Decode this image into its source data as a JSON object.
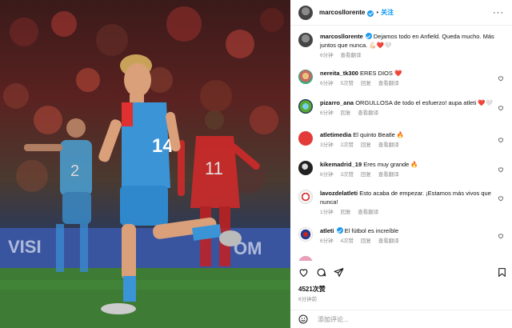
{
  "post": {
    "username": "marcosllorente",
    "follow_label": "关注",
    "more_label": "···"
  },
  "caption": {
    "username": "marcosllorente",
    "text": "Dejamos todo en Anfield. Queda mucho. Más juntos que nunca. 💪🏻❤️🤍",
    "time": "6分钟",
    "translate": "查看翻译"
  },
  "comments": [
    {
      "username": "nereita_tk300",
      "text": "ERES DIOS ❤️",
      "time": "6分钟",
      "likes": "5次赞",
      "reply": "回复",
      "translate": "查看翻译",
      "avatar": "av-1"
    },
    {
      "username": "pizarro_ana",
      "text": "ORGULLOSA de todo el esfuerzo! aupa atleti ❤️🤍",
      "time": "6分钟",
      "likes": "",
      "reply": "回复",
      "translate": "查看翻译",
      "avatar": "av-2"
    },
    {
      "username": "atletimedia",
      "text": "El quinto Beatle 🔥",
      "time": "3分钟",
      "likes": "2次赞",
      "reply": "回复",
      "translate": "查看翻译",
      "avatar": "av-3"
    },
    {
      "username": "kikemadrid_19",
      "text": "Eres muy grande 🔥",
      "time": "6分钟",
      "likes": "3次赞",
      "reply": "回复",
      "translate": "查看翻译",
      "avatar": "av-4"
    },
    {
      "username": "lavozdelatleti",
      "text": "Esto acaba de empezar. ¡Estamos más vivos que nunca!",
      "time": "1分钟",
      "likes": "",
      "reply": "回复",
      "translate": "查看翻译",
      "avatar": "av-5"
    },
    {
      "username": "atleti",
      "text": "El fútbol es increíble",
      "time": "6分钟",
      "likes": "4次赞",
      "reply": "回复",
      "translate": "查看翻译",
      "avatar": "av-6",
      "verified": true
    }
  ],
  "footer": {
    "likes": "4521次赞",
    "time": "6分钟前",
    "comment_placeholder": "添加评论..."
  },
  "colors": {
    "accent": "#0095f6",
    "verified": "#1d9bf0",
    "muted": "#8e8e8e"
  }
}
